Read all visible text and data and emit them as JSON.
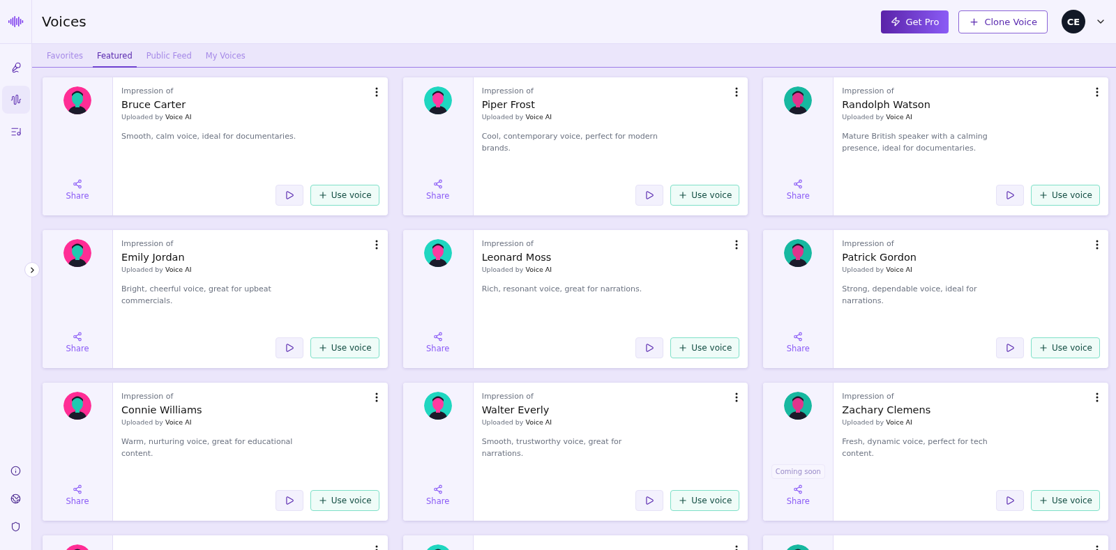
{
  "header": {
    "title": "Voices",
    "get_pro": "Get Pro",
    "clone_voice": "Clone Voice",
    "user_initials": "CE"
  },
  "sidebar": {
    "items": [
      {
        "kind": "mic",
        "selected": false
      },
      {
        "kind": "waveform",
        "selected": true
      },
      {
        "kind": "playlist",
        "selected": false
      }
    ],
    "bottom_items": [
      {
        "kind": "info"
      },
      {
        "kind": "globe"
      },
      {
        "kind": "shield"
      }
    ]
  },
  "tabs": [
    {
      "label": "Favorites",
      "selected": false
    },
    {
      "label": "Featured",
      "selected": true
    },
    {
      "label": "Public Feed",
      "selected": false
    },
    {
      "label": "My Voices",
      "selected": false
    }
  ],
  "voices": [
    {
      "overline": "Impression of",
      "name": "Bruce Carter",
      "uploaded_prefix": "Uploaded by",
      "uploader": "Voice AI",
      "description": "Smooth, calm voice, ideal for documentaries.",
      "share": "Share",
      "use": "Use voice"
    },
    {
      "overline": "Impression of",
      "name": "Piper Frost",
      "uploaded_prefix": "Uploaded by",
      "uploader": "Voice AI",
      "description": "Cool, contemporary voice, perfect for modern brands.",
      "share": "Share",
      "use": "Use voice"
    },
    {
      "overline": "Impression of",
      "name": "Randolph Watson",
      "uploaded_prefix": "Uploaded by",
      "uploader": "Voice AI",
      "description": "Mature British speaker with a calming presence, ideal for documentaries.",
      "share": "Share",
      "use": "Use voice"
    },
    {
      "overline": "Impression of",
      "name": "Emily Jordan",
      "uploaded_prefix": "Uploaded by",
      "uploader": "Voice AI",
      "description": "Bright, cheerful voice, great for upbeat commercials.",
      "share": "Share",
      "use": "Use voice"
    },
    {
      "overline": "Impression of",
      "name": "Leonard Moss",
      "uploaded_prefix": "Uploaded by",
      "uploader": "Voice AI",
      "description": "Rich, resonant voice, great for narrations.",
      "share": "Share",
      "use": "Use voice"
    },
    {
      "overline": "Impression of",
      "name": "Patrick Gordon",
      "uploaded_prefix": "Uploaded by",
      "uploader": "Voice AI",
      "description": "Strong, dependable voice, ideal for narrations.",
      "share": "Share",
      "use": "Use voice"
    },
    {
      "overline": "Impression of",
      "name": "Connie Williams",
      "uploaded_prefix": "Uploaded by",
      "uploader": "Voice AI",
      "description": "Warm, nurturing voice, great for educational content.",
      "share": "Share",
      "use": "Use voice"
    },
    {
      "overline": "Impression of",
      "name": "Walter Everly",
      "uploaded_prefix": "Uploaded by",
      "uploader": "Voice AI",
      "description": "Smooth, trustworthy voice, great for narrations.",
      "share": "Share",
      "use": "Use voice"
    },
    {
      "overline": "Impression of",
      "name": "Zachary Clemens",
      "uploaded_prefix": "Uploaded by",
      "uploader": "Voice AI",
      "description": "Fresh, dynamic voice, perfect for tech content.",
      "share": "Share",
      "use": "Use voice",
      "tooltip": "Coming soon"
    }
  ]
}
